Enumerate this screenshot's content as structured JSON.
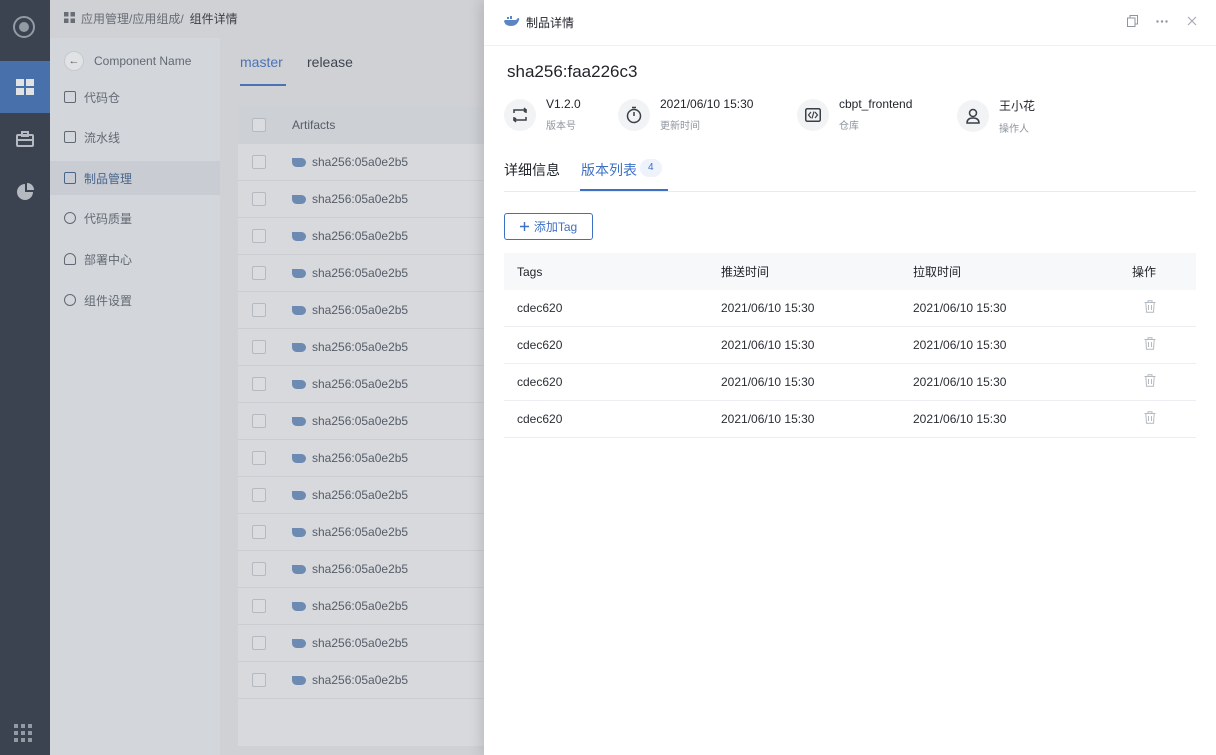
{
  "breadcrumb": {
    "part1": "应用管理/应用组成/",
    "current": "组件详情"
  },
  "component": {
    "name": "Component Name"
  },
  "nav": [
    {
      "label": "代码仓",
      "active": false
    },
    {
      "label": "流水线",
      "active": false
    },
    {
      "label": "制品管理",
      "active": true
    },
    {
      "label": "代码质量",
      "active": false
    },
    {
      "label": "部署中心",
      "active": false
    },
    {
      "label": "组件设置",
      "active": false
    }
  ],
  "branches": {
    "master": "master",
    "release": "release"
  },
  "artifacts": {
    "header": "Artifacts",
    "rows": [
      "sha256:05a0e2b5",
      "sha256:05a0e2b5",
      "sha256:05a0e2b5",
      "sha256:05a0e2b5",
      "sha256:05a0e2b5",
      "sha256:05a0e2b5",
      "sha256:05a0e2b5",
      "sha256:05a0e2b5",
      "sha256:05a0e2b5",
      "sha256:05a0e2b5",
      "sha256:05a0e2b5",
      "sha256:05a0e2b5",
      "sha256:05a0e2b5",
      "sha256:05a0e2b5",
      "sha256:05a0e2b5"
    ]
  },
  "drawer": {
    "title": "制品详情",
    "sha": "sha256:faa226c3",
    "meta": {
      "version": {
        "value": "V1.2.0",
        "label": "版本号"
      },
      "updated": {
        "value": "2021/06/10 15:30",
        "label": "更新时间"
      },
      "repo": {
        "value": "cbpt_frontend",
        "label": "仓库"
      },
      "operator": {
        "value": "王小花",
        "label": "操作人"
      }
    },
    "tabs": {
      "detail": "详细信息",
      "versions": "版本列表",
      "versions_count": "4"
    },
    "add_tag": "添加Tag",
    "table": {
      "headers": {
        "tags": "Tags",
        "push": "推送时间",
        "pull": "拉取时间",
        "ops": "操作"
      },
      "rows": [
        {
          "tag": "cdec620",
          "push": "2021/06/10 15:30",
          "pull": "2021/06/10 15:30"
        },
        {
          "tag": "cdec620",
          "push": "2021/06/10 15:30",
          "pull": "2021/06/10 15:30"
        },
        {
          "tag": "cdec620",
          "push": "2021/06/10 15:30",
          "pull": "2021/06/10 15:30"
        },
        {
          "tag": "cdec620",
          "push": "2021/06/10 15:30",
          "pull": "2021/06/10 15:30"
        }
      ]
    }
  },
  "colors": {
    "accent": "#3e71c4",
    "rail": "#2b3442",
    "rail_active": "#3b6fb6"
  }
}
